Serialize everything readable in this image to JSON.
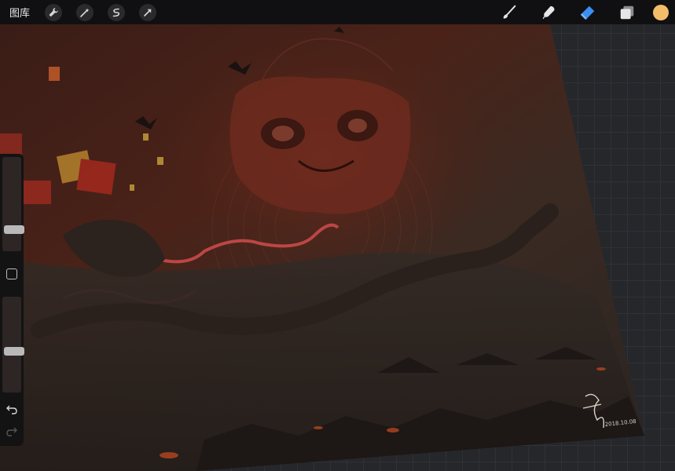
{
  "topbar": {
    "gallery_label": "图库",
    "left_tools": [
      {
        "name": "wrench-icon"
      },
      {
        "name": "magic-wand-icon"
      },
      {
        "name": "selection-icon"
      },
      {
        "name": "transform-arrow-icon"
      }
    ],
    "right_tools": [
      {
        "name": "brush-icon"
      },
      {
        "name": "smudge-icon"
      },
      {
        "name": "eraser-icon",
        "active": true
      },
      {
        "name": "layers-icon"
      }
    ],
    "current_color": "#f2bd68"
  },
  "sidebar": {
    "brush_size": 0.2,
    "opacity": 0.42
  },
  "artwork": {
    "signature_date": "2018.10.08"
  },
  "colors": {
    "accent_active": "#3b8ff2",
    "toolbar_bg": "#101012"
  }
}
